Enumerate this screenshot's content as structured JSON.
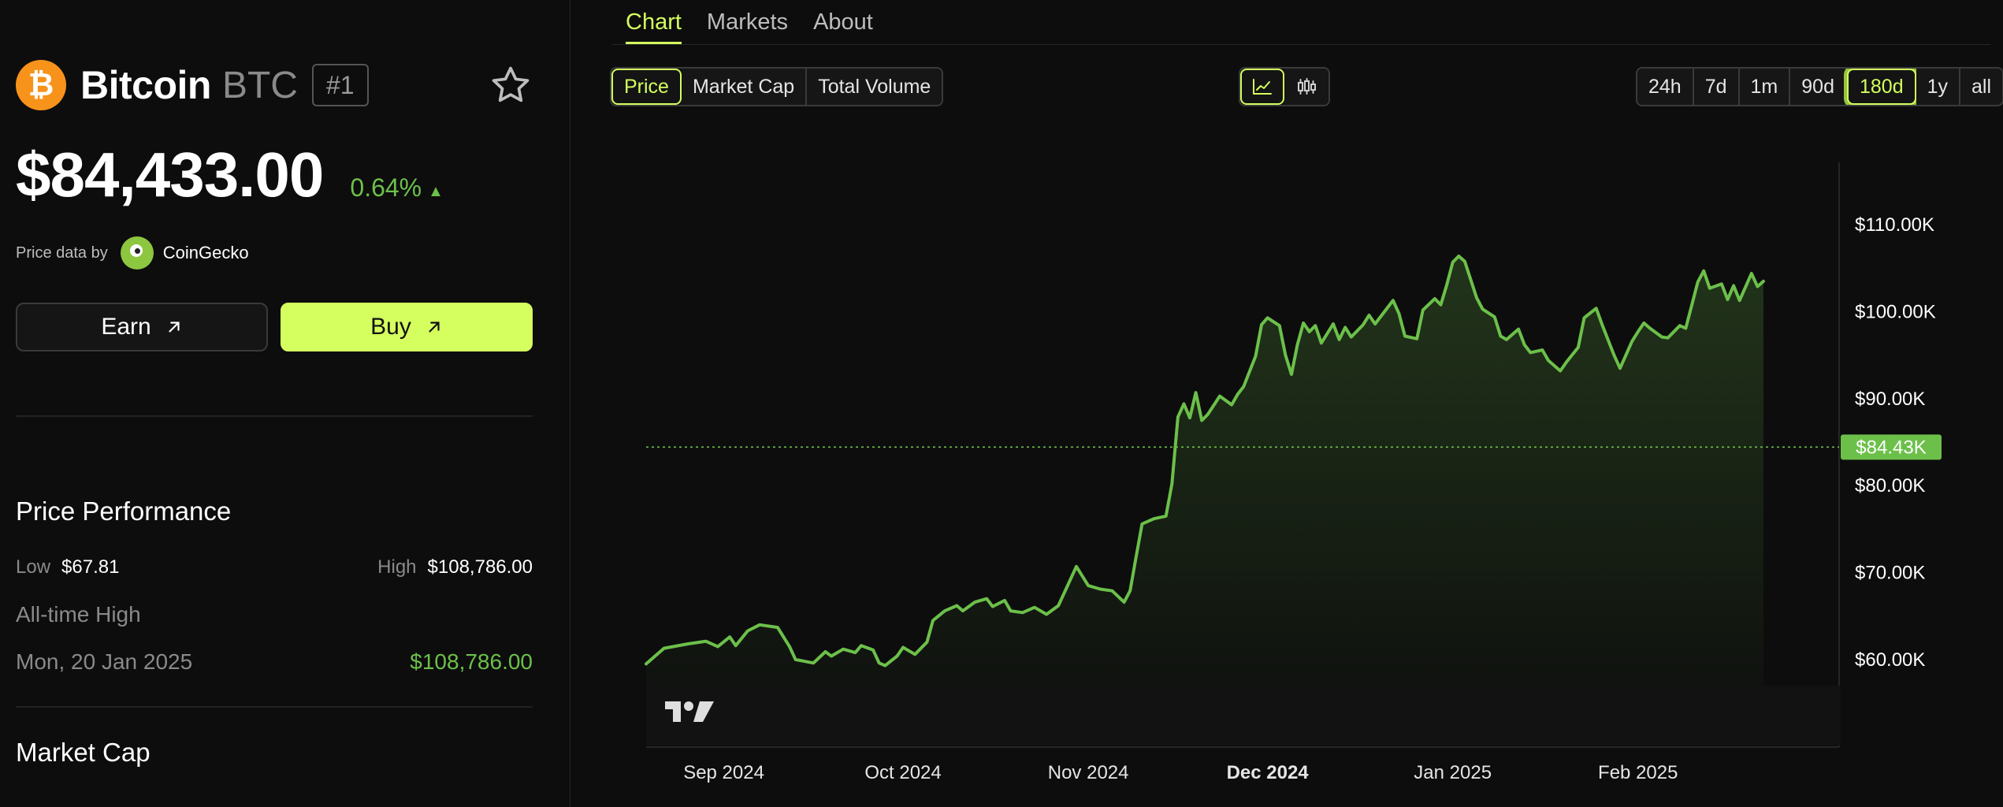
{
  "coin": {
    "name": "Bitcoin",
    "symbol": "BTC",
    "rank": "#1",
    "icon": "bitcoin-icon",
    "price": "$84,433.00",
    "change": "0.64%",
    "change_direction": "up"
  },
  "price_data": {
    "label": "Price data by",
    "provider": "CoinGecko"
  },
  "actions": {
    "earn_label": "Earn",
    "buy_label": "Buy"
  },
  "performance": {
    "title": "Price Performance",
    "low_label": "Low",
    "low_value": "$67.81",
    "high_label": "High",
    "high_value": "$108,786.00",
    "ath_label": "All-time High",
    "ath_date": "Mon, 20 Jan 2025",
    "ath_value": "$108,786.00"
  },
  "market_cap": {
    "title": "Market Cap"
  },
  "tabs": [
    {
      "label": "Chart",
      "active": true
    },
    {
      "label": "Markets",
      "active": false
    },
    {
      "label": "About",
      "active": false
    }
  ],
  "metric_buttons": [
    {
      "label": "Price",
      "active": true
    },
    {
      "label": "Market Cap",
      "active": false
    },
    {
      "label": "Total Volume",
      "active": false
    }
  ],
  "chart_types": [
    {
      "icon": "line-chart-icon",
      "active": true
    },
    {
      "icon": "candlestick-icon",
      "active": false
    }
  ],
  "ranges": [
    {
      "label": "24h",
      "active": false
    },
    {
      "label": "7d",
      "active": false
    },
    {
      "label": "1m",
      "active": false
    },
    {
      "label": "90d",
      "active": false
    },
    {
      "label": "180d",
      "active": true
    },
    {
      "label": "1y",
      "active": false
    },
    {
      "label": "all",
      "active": false
    }
  ],
  "colors": {
    "accent": "#d4ff5e",
    "line": "#6cc04a",
    "bitcoin": "#f7931a",
    "background": "#0d0d0d"
  },
  "chart_data": {
    "type": "area",
    "y_ticks": [
      60000,
      70000,
      80000,
      90000,
      100000,
      110000
    ],
    "y_tick_labels": [
      "$60.00K",
      "$70.00K",
      "$80.00K",
      "$90.00K",
      "$100.00K",
      "$110.00K"
    ],
    "ylim": [
      57000,
      117000
    ],
    "x_ticks": [
      {
        "date": "2024-09-01",
        "label": "Sep 2024",
        "bold": false
      },
      {
        "date": "2024-10-01",
        "label": "Oct 2024",
        "bold": false
      },
      {
        "date": "2024-11-01",
        "label": "Nov 2024",
        "bold": false
      },
      {
        "date": "2024-12-01",
        "label": "Dec 2024",
        "bold": true
      },
      {
        "date": "2025-01-01",
        "label": "Jan 2025",
        "bold": false
      },
      {
        "date": "2025-02-01",
        "label": "Feb 2025",
        "bold": false
      }
    ],
    "xlim": [
      "2024-08-19",
      "2025-02-22"
    ],
    "current": {
      "value": 84433,
      "label": "$84.43K"
    },
    "series": [
      {
        "values": [
          [
            "2024-08-19",
            59500
          ],
          [
            "2024-08-22",
            61300
          ],
          [
            "2024-08-26",
            61800
          ],
          [
            "2024-08-29",
            62100
          ],
          [
            "2024-08-31",
            61500
          ],
          [
            "2024-09-02",
            62600
          ],
          [
            "2024-09-03",
            61600
          ],
          [
            "2024-09-05",
            63300
          ],
          [
            "2024-09-07",
            64000
          ],
          [
            "2024-09-10",
            63700
          ],
          [
            "2024-09-12",
            61500
          ],
          [
            "2024-09-13",
            60000
          ],
          [
            "2024-09-16",
            59600
          ],
          [
            "2024-09-18",
            60900
          ],
          [
            "2024-09-19",
            60400
          ],
          [
            "2024-09-21",
            61200
          ],
          [
            "2024-09-23",
            60800
          ],
          [
            "2024-09-24",
            61600
          ],
          [
            "2024-09-26",
            61100
          ],
          [
            "2024-09-27",
            59600
          ],
          [
            "2024-09-28",
            59300
          ],
          [
            "2024-09-30",
            60400
          ],
          [
            "2024-10-01",
            61400
          ],
          [
            "2024-10-03",
            60600
          ],
          [
            "2024-10-05",
            62000
          ],
          [
            "2024-10-06",
            64500
          ],
          [
            "2024-10-08",
            65600
          ],
          [
            "2024-10-10",
            66200
          ],
          [
            "2024-10-11",
            65600
          ],
          [
            "2024-10-13",
            66600
          ],
          [
            "2024-10-15",
            67000
          ],
          [
            "2024-10-16",
            66100
          ],
          [
            "2024-10-18",
            66800
          ],
          [
            "2024-10-19",
            65600
          ],
          [
            "2024-10-21",
            65400
          ],
          [
            "2024-10-23",
            66000
          ],
          [
            "2024-10-25",
            65200
          ],
          [
            "2024-10-27",
            66200
          ],
          [
            "2024-10-29",
            69200
          ],
          [
            "2024-10-30",
            70700
          ],
          [
            "2024-10-31",
            69600
          ],
          [
            "2024-11-01",
            68500
          ],
          [
            "2024-11-03",
            68100
          ],
          [
            "2024-11-05",
            67900
          ],
          [
            "2024-11-07",
            66600
          ],
          [
            "2024-11-08",
            67900
          ],
          [
            "2024-11-09",
            71800
          ],
          [
            "2024-11-10",
            75600
          ],
          [
            "2024-11-12",
            76200
          ],
          [
            "2024-11-14",
            76500
          ],
          [
            "2024-11-15",
            80200
          ],
          [
            "2024-11-16",
            87900
          ],
          [
            "2024-11-17",
            89400
          ],
          [
            "2024-11-18",
            87800
          ],
          [
            "2024-11-19",
            90700
          ],
          [
            "2024-11-20",
            87500
          ],
          [
            "2024-11-21",
            88200
          ],
          [
            "2024-11-23",
            90300
          ],
          [
            "2024-11-25",
            89300
          ],
          [
            "2024-11-26",
            90500
          ],
          [
            "2024-11-27",
            91400
          ],
          [
            "2024-11-29",
            94900
          ],
          [
            "2024-11-30",
            98500
          ],
          [
            "2024-12-01",
            99300
          ],
          [
            "2024-12-03",
            98400
          ],
          [
            "2024-12-04",
            95000
          ],
          [
            "2024-12-05",
            92800
          ],
          [
            "2024-12-06",
            96200
          ],
          [
            "2024-12-07",
            98700
          ],
          [
            "2024-12-08",
            97700
          ],
          [
            "2024-12-09",
            98400
          ],
          [
            "2024-12-10",
            96400
          ],
          [
            "2024-12-12",
            98600
          ],
          [
            "2024-12-13",
            96800
          ],
          [
            "2024-12-14",
            98200
          ],
          [
            "2024-12-15",
            97100
          ],
          [
            "2024-12-17",
            98500
          ],
          [
            "2024-12-18",
            99600
          ],
          [
            "2024-12-19",
            98600
          ],
          [
            "2024-12-20",
            99500
          ],
          [
            "2024-12-22",
            101300
          ],
          [
            "2024-12-23",
            99800
          ],
          [
            "2024-12-24",
            97200
          ],
          [
            "2024-12-26",
            96900
          ],
          [
            "2024-12-27",
            100200
          ],
          [
            "2024-12-29",
            101500
          ],
          [
            "2024-12-30",
            100800
          ],
          [
            "2024-12-31",
            103100
          ],
          [
            "2025-01-01",
            105700
          ],
          [
            "2025-01-02",
            106400
          ],
          [
            "2025-01-03",
            105800
          ],
          [
            "2025-01-05",
            101600
          ],
          [
            "2025-01-06",
            100300
          ],
          [
            "2025-01-08",
            99400
          ],
          [
            "2025-01-09",
            97200
          ],
          [
            "2025-01-10",
            96800
          ],
          [
            "2025-01-12",
            98000
          ],
          [
            "2025-01-13",
            96200
          ],
          [
            "2025-01-14",
            95300
          ],
          [
            "2025-01-16",
            95600
          ],
          [
            "2025-01-17",
            94400
          ],
          [
            "2025-01-19",
            93200
          ],
          [
            "2025-01-20",
            94200
          ],
          [
            "2025-01-22",
            95900
          ],
          [
            "2025-01-23",
            99300
          ],
          [
            "2025-01-25",
            100400
          ],
          [
            "2025-01-26",
            98500
          ],
          [
            "2025-01-28",
            95000
          ],
          [
            "2025-01-29",
            93500
          ],
          [
            "2025-01-31",
            96600
          ],
          [
            "2025-02-01",
            97700
          ],
          [
            "2025-02-02",
            98700
          ],
          [
            "2025-02-03",
            98100
          ],
          [
            "2025-02-05",
            97100
          ],
          [
            "2025-02-06",
            97000
          ],
          [
            "2025-02-08",
            98400
          ],
          [
            "2025-02-09",
            98100
          ],
          [
            "2025-02-11",
            103400
          ],
          [
            "2025-02-12",
            104700
          ],
          [
            "2025-02-13",
            102700
          ],
          [
            "2025-02-15",
            103200
          ],
          [
            "2025-02-16",
            101400
          ],
          [
            "2025-02-17",
            103000
          ],
          [
            "2025-02-18",
            101300
          ],
          [
            "2025-02-20",
            104400
          ],
          [
            "2025-02-21",
            102900
          ],
          [
            "2025-02-22",
            103500
          ]
        ]
      }
    ]
  }
}
